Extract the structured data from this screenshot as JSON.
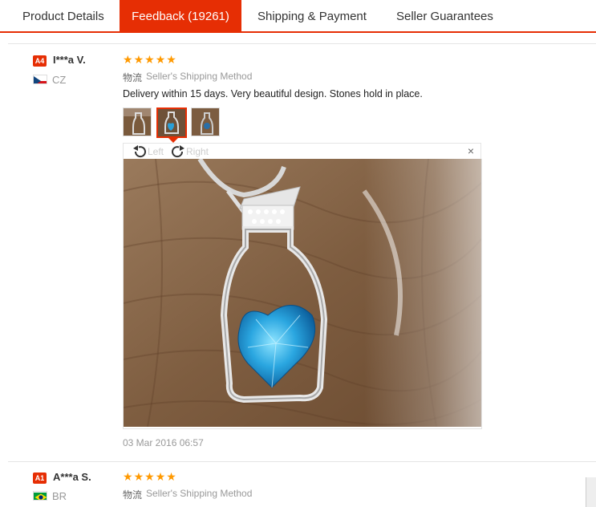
{
  "tabs": [
    {
      "label": "Product Details"
    },
    {
      "label": "Feedback (19261)"
    },
    {
      "label": "Shipping & Payment"
    },
    {
      "label": "Seller Guarantees"
    }
  ],
  "colors": {
    "accent": "#e62e04",
    "star": "#ff9900"
  },
  "reviews": [
    {
      "level": "A4",
      "name": "I***a V.",
      "country": "CZ",
      "stars": 5,
      "logistics_cn": "物流",
      "logistics_en": "Seller's Shipping Method",
      "text": "Delivery within 15 days. Very beautiful design. Stones hold in place.",
      "viewer": {
        "rotate_left": "Left",
        "rotate_right": "Right",
        "close": "×"
      },
      "date": "03 Mar 2016 06:57"
    },
    {
      "level": "A1",
      "name": "A***a S.",
      "country": "BR",
      "stars": 5,
      "logistics_cn": "物流",
      "logistics_en": "Seller's Shipping Method"
    }
  ]
}
